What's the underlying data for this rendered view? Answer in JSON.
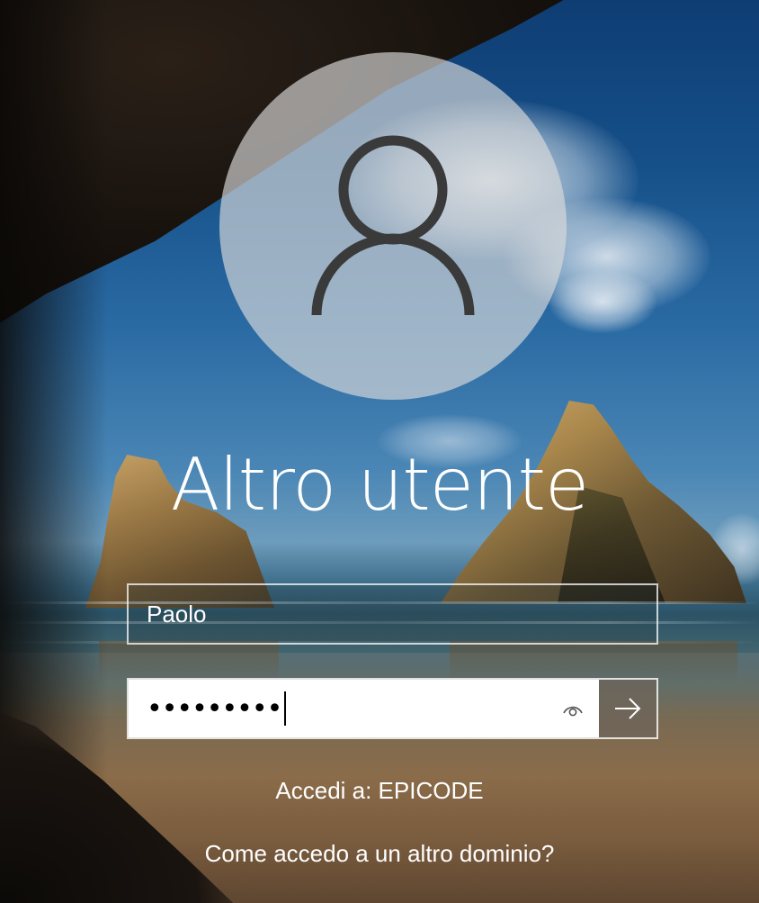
{
  "login": {
    "username_title": "Altro utente",
    "user_field_value": "Paolo",
    "password_masked": "•••••••••",
    "signin_to_text": "Accedi a: EPICODE",
    "other_domain_link": "Come accedo a un altro dominio?"
  },
  "icons": {
    "avatar": "user-silhouette-icon",
    "reveal": "eye-icon",
    "submit": "arrow-right-icon"
  },
  "colors": {
    "text": "#ffffff",
    "avatar_circle": "#dadada",
    "avatar_figure": "#3a3a3a",
    "submit_bg": "#6e645a"
  }
}
